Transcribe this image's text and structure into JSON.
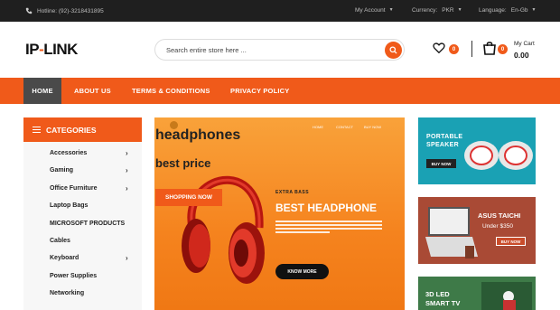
{
  "topbar": {
    "hotline": "Hotline: (92)-3218431895",
    "my_account": "My Account",
    "currency_label": "Currency:",
    "currency_value": "PKR",
    "language_label": "Language:",
    "language_value": "En-Gb"
  },
  "header": {
    "logo_left": "IP",
    "logo_dash": "-",
    "logo_right": "LINK",
    "search_placeholder": "Search entire store here ...",
    "wishlist_count": "0",
    "cart_count": "0",
    "cart_label": "My Cart",
    "cart_total": "0.00"
  },
  "nav": {
    "items": [
      "HOME",
      "ABOUT US",
      "TERMS & CONDITIONS",
      "PRIVACY POLICY"
    ]
  },
  "categories": {
    "title": "CATEGORIES",
    "items": [
      {
        "label": "Accessories",
        "has_sub": true
      },
      {
        "label": "Gaming",
        "has_sub": true
      },
      {
        "label": "Office Furniture",
        "has_sub": true
      },
      {
        "label": "Laptop Bags",
        "has_sub": false
      },
      {
        "label": "MICROSOFT PRODUCTS",
        "has_sub": false
      },
      {
        "label": "Cables",
        "has_sub": false
      },
      {
        "label": "Keyboard",
        "has_sub": true
      },
      {
        "label": "Power Supplies",
        "has_sub": false
      },
      {
        "label": "Networking",
        "has_sub": false
      }
    ]
  },
  "hero": {
    "title": "headphones",
    "subtitle": "best price",
    "cta": "SHOPPING NOW",
    "nav_home": "HOME",
    "nav_contact": "CONTACT",
    "nav_buy": "BUY NOW",
    "tag": "EXTRA BASS",
    "headline": "BEST HEADPHONE",
    "more": "KNOW MORE"
  },
  "banners": {
    "speaker_line1": "PORTABLE",
    "speaker_line2": "SPEAKER",
    "speaker_buy": "BUY NOW",
    "laptop_title": "ASUS TAICHI",
    "laptop_price": "Under $350",
    "laptop_buy": "BUY NOW",
    "tv_line1": "3D LED",
    "tv_line2": "SMART TV"
  },
  "colors": {
    "accent": "#f05a1a",
    "topbar": "#1f1f1f",
    "nav_active": "#4a4a4a"
  }
}
